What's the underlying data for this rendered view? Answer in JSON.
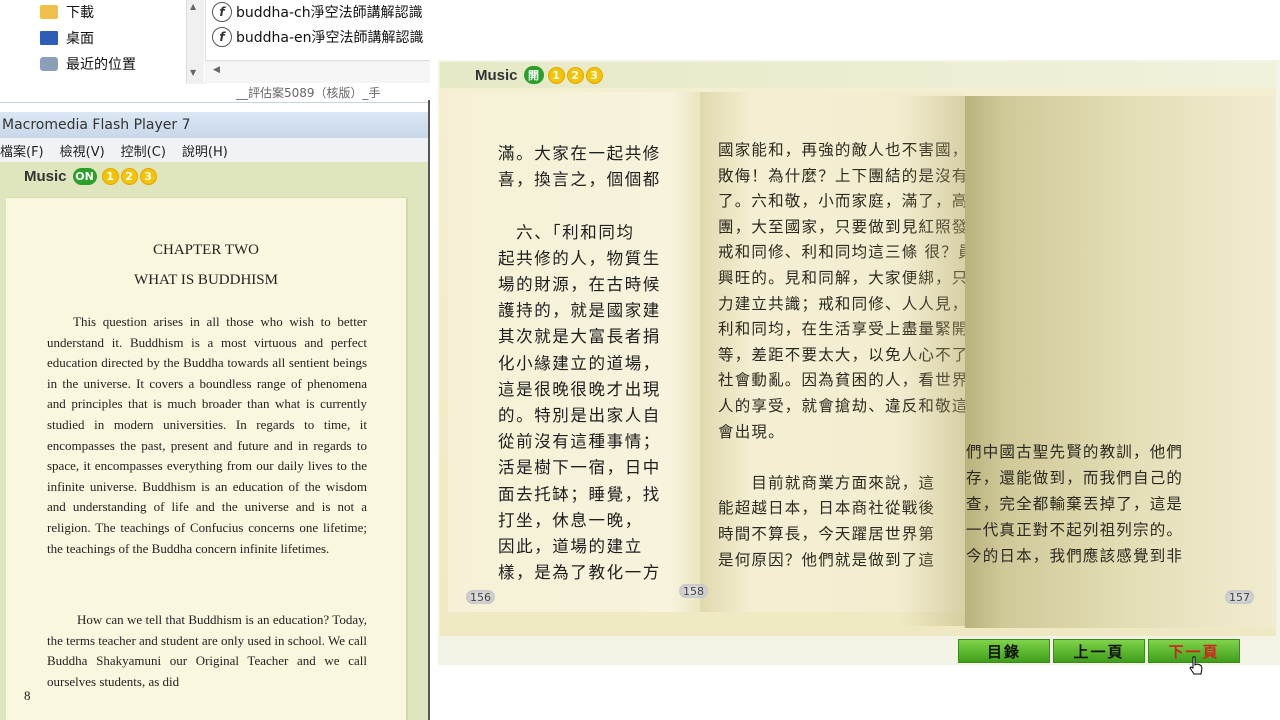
{
  "explorer": {
    "nav_items": [
      {
        "label": "下載",
        "icon": "download-folder-icon"
      },
      {
        "label": "桌面",
        "icon": "desktop-icon"
      },
      {
        "label": "最近的位置",
        "icon": "recent-places-icon"
      }
    ],
    "files": [
      {
        "name": "buddha-ch淨空法師講解認識"
      },
      {
        "name": "buddha-en淨空法師講解認識"
      }
    ],
    "status_text": "__評估案5089（核版）_手"
  },
  "flash_window": {
    "title": "Macromedia Flash Player 7",
    "menu": [
      "檔案(F)",
      "檢視(V)",
      "控制(C)",
      "說明(H)"
    ],
    "music": {
      "label": "Music",
      "toggle": "ON",
      "tracks": [
        "1",
        "2",
        "3"
      ]
    },
    "page": {
      "chapter": "CHAPTER TWO",
      "title": "WHAT IS BUDDHISM",
      "paragraphs": [
        "This question arises in all those who wish to better understand it. Buddhism is a most virtuous and perfect education directed by the Buddha towards all sentient beings in the universe. It covers a boundless range of phenomena and principles that is much broader than what is currently studied in modern universities. In regards to time, it encompasses the past, present and future and in regards to space, it encompasses everything from our daily lives to the infinite universe. Buddhism is an education of the wisdom and understanding of life and the universe and is not a religion. The teachings of Confucius concerns one lifetime; the teachings of the Buddha concern infinite lifetimes.",
        "How can we tell that Buddhism is an education? Today, the terms teacher and student are only used in school. We call Buddha Shakyamuni our Original Teacher and we call ourselves students, as did"
      ],
      "page_number": "8"
    }
  },
  "book_viewer": {
    "music": {
      "label": "Music",
      "toggle": "開",
      "tracks": [
        "1",
        "2",
        "3"
      ]
    },
    "left_page_columns": [
      "滿。大家在一起共修",
      "喜，換言之，個個都",
      "",
      "　六、「利和同均",
      "起共修的人，物質生",
      "場的財源，在古時候",
      "護持的，就是國家建",
      "其次就是大富長者捐",
      "化小緣建立的道場，",
      "這是很晚很晚才出現",
      "的。特別是出家人自",
      "從前沒有這種事情；",
      "活是樹下一宿，日中",
      "面去托缽；睡覺，找",
      "打坐，休息一晚，",
      "因此，道場的建立",
      "樣，是為了教化一方"
    ],
    "right_page_lines": [
      "國家能和，再強的敵人也不害國，工商業無法和日本相抗",
      "敗侮！為什麼？上下團結的是沒有這三條，在日本，商社",
      "了。六和敬，小而家庭，滿了，高階層的人不發薪水，",
      "團，大至國家，只要做到見紅照發。所以，員工怎能不",
      "戒和同修、利和同均這三條 很？員工有意見絕對不罷工，",
      "興旺的。見和同解，大家便綁，只在頭上綁條白布，表示",
      "力建立共識；戒和同修、人人見，我要反抗你」。老闆看",
      "利和同均，在生活享受上盡量緊開會，溝通、協調，如此",
      "等，差距不要太大，以免人心不了，生產也不延誤。所以，",
      "社會動亂。因為貧困的人，看世界第一流富大國，就是做",
      "人的享受，就會搶劫、違反和敬這三條，日本人的長處很",
      "會出現。",
      "",
      "　　目前就商業方面來說，這",
      "能超越日本，日本商社從戰後",
      "時間不算長，今天躍居世界第",
      "是何原因？他們就是做到了這"
    ],
    "flip_page_lines": [
      "們中國古聖先賢的教訓，他們",
      "存，還能做到，而我們自己的",
      "查，完全都輸棄丟掉了，這是",
      "一代真正對不起列祖列宗的。",
      "今的日本，我們應該感覺到非"
    ],
    "page_numbers": {
      "left": "156",
      "middle": "158",
      "right": "157"
    },
    "nav_buttons": [
      {
        "label": "目錄"
      },
      {
        "label": "上一頁"
      },
      {
        "label": "下一頁"
      }
    ],
    "colors": {
      "nav_green": "#4cae22",
      "active_red": "#d32020",
      "on_green": "#2aa02a",
      "track_yellow": "#f5c400"
    }
  }
}
